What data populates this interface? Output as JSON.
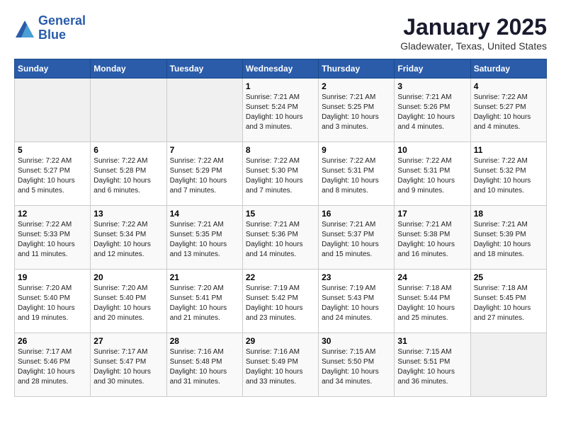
{
  "logo": {
    "line1": "General",
    "line2": "Blue"
  },
  "title": "January 2025",
  "subtitle": "Gladewater, Texas, United States",
  "headers": [
    "Sunday",
    "Monday",
    "Tuesday",
    "Wednesday",
    "Thursday",
    "Friday",
    "Saturday"
  ],
  "weeks": [
    [
      {
        "day": "",
        "info": ""
      },
      {
        "day": "",
        "info": ""
      },
      {
        "day": "",
        "info": ""
      },
      {
        "day": "1",
        "info": "Sunrise: 7:21 AM\nSunset: 5:24 PM\nDaylight: 10 hours\nand 3 minutes."
      },
      {
        "day": "2",
        "info": "Sunrise: 7:21 AM\nSunset: 5:25 PM\nDaylight: 10 hours\nand 3 minutes."
      },
      {
        "day": "3",
        "info": "Sunrise: 7:21 AM\nSunset: 5:26 PM\nDaylight: 10 hours\nand 4 minutes."
      },
      {
        "day": "4",
        "info": "Sunrise: 7:22 AM\nSunset: 5:27 PM\nDaylight: 10 hours\nand 4 minutes."
      }
    ],
    [
      {
        "day": "5",
        "info": "Sunrise: 7:22 AM\nSunset: 5:27 PM\nDaylight: 10 hours\nand 5 minutes."
      },
      {
        "day": "6",
        "info": "Sunrise: 7:22 AM\nSunset: 5:28 PM\nDaylight: 10 hours\nand 6 minutes."
      },
      {
        "day": "7",
        "info": "Sunrise: 7:22 AM\nSunset: 5:29 PM\nDaylight: 10 hours\nand 7 minutes."
      },
      {
        "day": "8",
        "info": "Sunrise: 7:22 AM\nSunset: 5:30 PM\nDaylight: 10 hours\nand 7 minutes."
      },
      {
        "day": "9",
        "info": "Sunrise: 7:22 AM\nSunset: 5:31 PM\nDaylight: 10 hours\nand 8 minutes."
      },
      {
        "day": "10",
        "info": "Sunrise: 7:22 AM\nSunset: 5:31 PM\nDaylight: 10 hours\nand 9 minutes."
      },
      {
        "day": "11",
        "info": "Sunrise: 7:22 AM\nSunset: 5:32 PM\nDaylight: 10 hours\nand 10 minutes."
      }
    ],
    [
      {
        "day": "12",
        "info": "Sunrise: 7:22 AM\nSunset: 5:33 PM\nDaylight: 10 hours\nand 11 minutes."
      },
      {
        "day": "13",
        "info": "Sunrise: 7:22 AM\nSunset: 5:34 PM\nDaylight: 10 hours\nand 12 minutes."
      },
      {
        "day": "14",
        "info": "Sunrise: 7:21 AM\nSunset: 5:35 PM\nDaylight: 10 hours\nand 13 minutes."
      },
      {
        "day": "15",
        "info": "Sunrise: 7:21 AM\nSunset: 5:36 PM\nDaylight: 10 hours\nand 14 minutes."
      },
      {
        "day": "16",
        "info": "Sunrise: 7:21 AM\nSunset: 5:37 PM\nDaylight: 10 hours\nand 15 minutes."
      },
      {
        "day": "17",
        "info": "Sunrise: 7:21 AM\nSunset: 5:38 PM\nDaylight: 10 hours\nand 16 minutes."
      },
      {
        "day": "18",
        "info": "Sunrise: 7:21 AM\nSunset: 5:39 PM\nDaylight: 10 hours\nand 18 minutes."
      }
    ],
    [
      {
        "day": "19",
        "info": "Sunrise: 7:20 AM\nSunset: 5:40 PM\nDaylight: 10 hours\nand 19 minutes."
      },
      {
        "day": "20",
        "info": "Sunrise: 7:20 AM\nSunset: 5:40 PM\nDaylight: 10 hours\nand 20 minutes."
      },
      {
        "day": "21",
        "info": "Sunrise: 7:20 AM\nSunset: 5:41 PM\nDaylight: 10 hours\nand 21 minutes."
      },
      {
        "day": "22",
        "info": "Sunrise: 7:19 AM\nSunset: 5:42 PM\nDaylight: 10 hours\nand 23 minutes."
      },
      {
        "day": "23",
        "info": "Sunrise: 7:19 AM\nSunset: 5:43 PM\nDaylight: 10 hours\nand 24 minutes."
      },
      {
        "day": "24",
        "info": "Sunrise: 7:18 AM\nSunset: 5:44 PM\nDaylight: 10 hours\nand 25 minutes."
      },
      {
        "day": "25",
        "info": "Sunrise: 7:18 AM\nSunset: 5:45 PM\nDaylight: 10 hours\nand 27 minutes."
      }
    ],
    [
      {
        "day": "26",
        "info": "Sunrise: 7:17 AM\nSunset: 5:46 PM\nDaylight: 10 hours\nand 28 minutes."
      },
      {
        "day": "27",
        "info": "Sunrise: 7:17 AM\nSunset: 5:47 PM\nDaylight: 10 hours\nand 30 minutes."
      },
      {
        "day": "28",
        "info": "Sunrise: 7:16 AM\nSunset: 5:48 PM\nDaylight: 10 hours\nand 31 minutes."
      },
      {
        "day": "29",
        "info": "Sunrise: 7:16 AM\nSunset: 5:49 PM\nDaylight: 10 hours\nand 33 minutes."
      },
      {
        "day": "30",
        "info": "Sunrise: 7:15 AM\nSunset: 5:50 PM\nDaylight: 10 hours\nand 34 minutes."
      },
      {
        "day": "31",
        "info": "Sunrise: 7:15 AM\nSunset: 5:51 PM\nDaylight: 10 hours\nand 36 minutes."
      },
      {
        "day": "",
        "info": ""
      }
    ]
  ]
}
